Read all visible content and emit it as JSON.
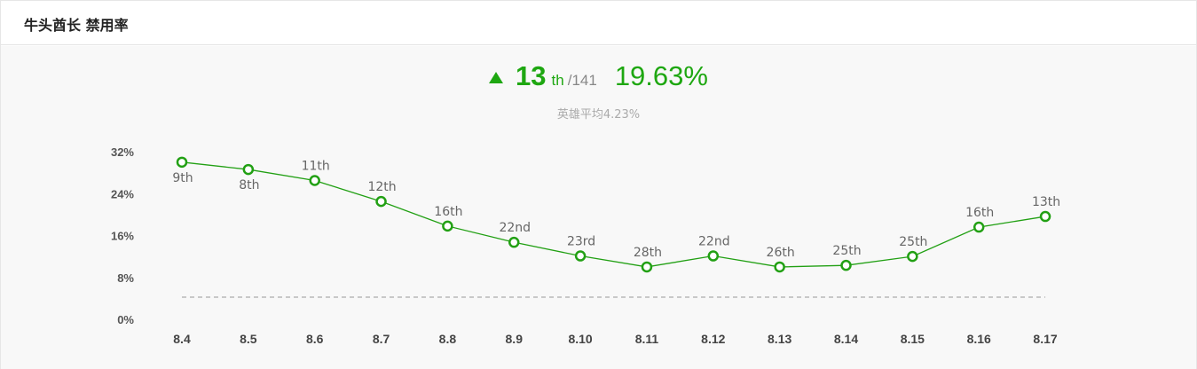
{
  "panel": {
    "title": "牛头酋长 禁用率"
  },
  "summary": {
    "trend": "up",
    "rank": "13",
    "rank_suffix": "th",
    "rank_total": "/141",
    "ban_rate": "19.63%",
    "average_text": "英雄平均4.23%"
  },
  "colors": {
    "accent": "#1ea711",
    "line": "#22a014",
    "average_line": "#999999"
  },
  "chart_data": {
    "type": "line",
    "title": "",
    "xlabel": "",
    "ylabel": "",
    "ylim": [
      0,
      32
    ],
    "yticks": [
      "0%",
      "8%",
      "16%",
      "24%",
      "32%"
    ],
    "ytick_values": [
      0,
      8,
      16,
      24,
      32
    ],
    "categories": [
      "8.4",
      "8.5",
      "8.6",
      "8.7",
      "8.8",
      "8.9",
      "8.10",
      "8.11",
      "8.12",
      "8.13",
      "8.14",
      "8.15",
      "8.16",
      "8.17"
    ],
    "series": [
      {
        "values": [
          30.0,
          28.6,
          26.5,
          22.5,
          17.8,
          14.7,
          12.1,
          10.0,
          12.1,
          10.0,
          10.3,
          12.0,
          17.6,
          19.63
        ],
        "point_labels": [
          "9th",
          "8th",
          "11th",
          "12th",
          "16th",
          "22nd",
          "23rd",
          "28th",
          "22nd",
          "26th",
          "25th",
          "25th",
          "16th",
          "13th"
        ],
        "label_position": [
          "below",
          "below",
          "above",
          "above",
          "above",
          "above",
          "above",
          "above",
          "above",
          "above",
          "above",
          "above",
          "above",
          "above"
        ]
      }
    ],
    "average": 4.23,
    "grid": false,
    "legend": "none"
  }
}
